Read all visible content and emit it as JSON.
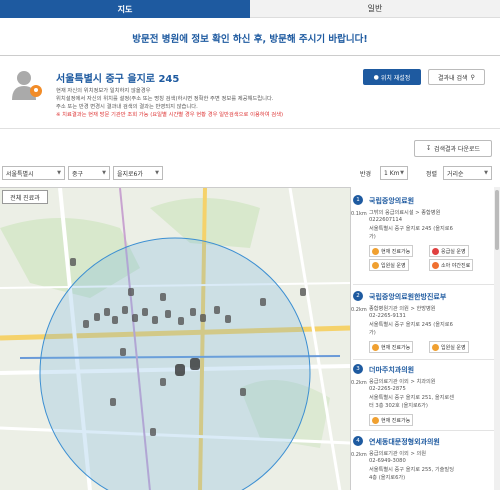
{
  "tabs": [
    {
      "label": "지도"
    },
    {
      "label": "일반"
    }
  ],
  "notice": "방문전 병원에 정보 확인 하신 후, 방문해 주시기 바랍니다!",
  "location": {
    "title": "서울특별시 중구 을지로 245",
    "lines": [
      "현재 자신의 위치정보가 일치하지 않을경우",
      "위치설정에서 자신의 위치를 설정(주소 또는 명칭 검색)하시면 정확한 주변 정보를 제공해드립니다.",
      "주소 또는 반경 변경시 결과내 검색의 결과는 반영되지 않습니다.",
      "※ 치료결과는 현재 방문 기관만 조회 가능 (요일별 시간별 경우 현황 경우 일반검색으로 이용하여 검색)"
    ],
    "reset_label": "위치 재설정",
    "search_label": "결과내 검색"
  },
  "download_label": "검색결과 다운로드",
  "filters": {
    "sido": "서울특별시",
    "sigungu": "중구",
    "dong": "을지로6가",
    "radius_label": "반경",
    "radius": "1 Km",
    "sort_label": "정렬",
    "sort": "거리순"
  },
  "map": {
    "tab_label": "전체 진료과"
  },
  "results": [
    {
      "num": "1",
      "name": "국립중앙의료원",
      "dist": "0.1km",
      "type": "그밖의 응급의료시설 > 종합병원",
      "phone": "0222607114",
      "addr1": "서울특별시 중구 을지로 245 (을지로6",
      "addr2": "가)",
      "badges": [
        "현재 진료가능",
        "응급실 운영",
        "입원실 운영",
        "소아 야간진료"
      ]
    },
    {
      "num": "2",
      "name": "국립중앙의료원한방진료부",
      "dist": "0.2km",
      "type": "종합병원기관 의원 > 한방병원",
      "phone": "02-2265-9131",
      "addr1": "서울특별시 중구 을지로 245 (을지로6",
      "addr2": "가)",
      "badges": [
        "현재 진료가능",
        "입원실 운영"
      ]
    },
    {
      "num": "3",
      "name": "더마주치과의원",
      "dist": "0.2km",
      "type": "응급의료기관 이외 > 치과의원",
      "phone": "02-2265-2875",
      "addr1": "서울특별시 중구 을지로 251, 을지로센",
      "addr2": "터 3층 302호 (을지로6가)",
      "badges": [
        "현재 진료가능"
      ]
    },
    {
      "num": "4",
      "name": "연세동대문정형외과의원",
      "dist": "0.2km",
      "type": "응급의료기관 이외 > 의원",
      "phone": "02-6949-3080",
      "addr1": "서울특별시 중구 을지로 255, 기술빌딩",
      "addr2": "4층 (을지로6가)",
      "badges": []
    }
  ]
}
